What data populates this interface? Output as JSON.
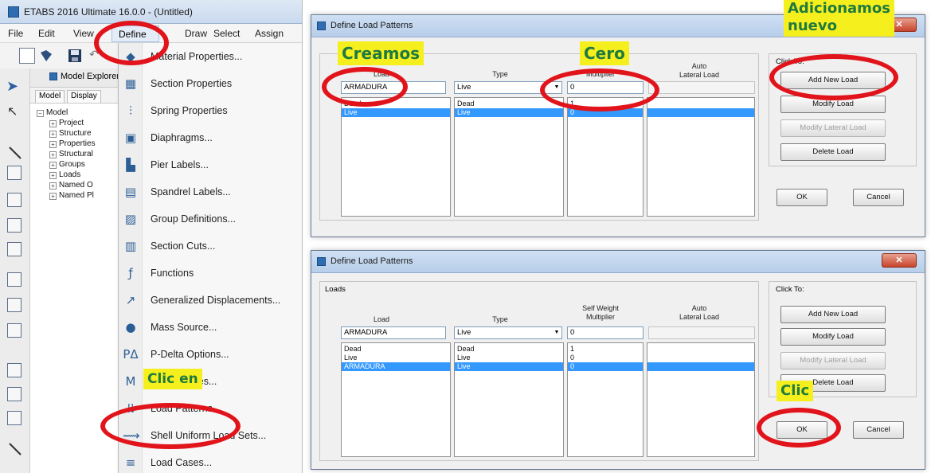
{
  "app": {
    "title": "ETABS 2016 Ultimate 16.0.0 - (Untitled)",
    "menu": [
      "File",
      "Edit",
      "View",
      "Define",
      "Draw",
      "Select",
      "Assign"
    ]
  },
  "explorer": {
    "title": "Model Explorer",
    "tabs": [
      "Model",
      "Display"
    ],
    "tree": [
      {
        "label": "Model",
        "level": 0,
        "sign": "−"
      },
      {
        "label": "Project",
        "level": 1,
        "sign": "+"
      },
      {
        "label": "Structure",
        "level": 1,
        "sign": "+"
      },
      {
        "label": "Properties",
        "level": 1,
        "sign": "+"
      },
      {
        "label": "Structural",
        "level": 1,
        "sign": "+"
      },
      {
        "label": "Groups",
        "level": 1,
        "sign": "+"
      },
      {
        "label": "Loads",
        "level": 1,
        "sign": "+"
      },
      {
        "label": "Named O",
        "level": 1,
        "sign": "+"
      },
      {
        "label": "Named Pl",
        "level": 1,
        "sign": "+"
      }
    ]
  },
  "define_menu": {
    "items": [
      {
        "label": "Material Properties...",
        "icon": "material-icon",
        "glyph": "◆"
      },
      {
        "label": "Section Properties",
        "icon": "section-icon",
        "glyph": "▦"
      },
      {
        "label": "Spring Properties",
        "icon": "spring-icon",
        "glyph": "⫶"
      },
      {
        "label": "Diaphragms...",
        "icon": "diaphragm-icon",
        "glyph": "▣"
      },
      {
        "label": "Pier Labels...",
        "icon": "pier-icon",
        "glyph": "▙"
      },
      {
        "label": "Spandrel Labels...",
        "icon": "spandrel-icon",
        "glyph": "▤"
      },
      {
        "label": "Group Definitions...",
        "icon": "group-icon",
        "glyph": "▨"
      },
      {
        "label": "Section Cuts...",
        "icon": "section-cut-icon",
        "glyph": "▥"
      },
      {
        "label": "Functions",
        "icon": "functions-icon",
        "glyph": "ƒ"
      },
      {
        "label": "Generalized Displacements...",
        "icon": "displacement-icon",
        "glyph": "↗"
      },
      {
        "label": "Mass Source...",
        "icon": "mass-icon",
        "glyph": "●"
      },
      {
        "label": "P-Delta Options...",
        "icon": "pdelta-icon",
        "glyph": "PΔ"
      },
      {
        "label": "Modal Cases...",
        "icon": "modal-icon",
        "glyph": "M"
      },
      {
        "label": "Load Patterns...",
        "icon": "load-patterns-icon",
        "glyph": "⇊"
      },
      {
        "label": "Shell Uniform Load Sets...",
        "icon": "shell-load-icon",
        "glyph": "⟿"
      },
      {
        "label": "Load Cases...",
        "icon": "load-cases-icon",
        "glyph": "≡"
      }
    ]
  },
  "dialog_top": {
    "title": "Define Load Patterns",
    "click_to": "Click To:",
    "headers": {
      "load": "Load",
      "type": "Type",
      "multiplier": "Multiplier",
      "auto": "Auto\nLateral Load"
    },
    "input_load": "ARMADURA",
    "input_type": "Live",
    "input_multiplier": "0",
    "rows": [
      {
        "load": "Dead",
        "type": "Dead",
        "mult": "1",
        "sel": false
      },
      {
        "load": "Live",
        "type": "Live",
        "mult": "0",
        "sel": true
      }
    ],
    "buttons": {
      "add": "Add New Load",
      "modify": "Modify Load",
      "modify_lateral": "Modify Lateral Load",
      "delete": "Delete Load",
      "ok": "OK",
      "cancel": "Cancel"
    }
  },
  "dialog_bottom": {
    "title": "Define Load Patterns",
    "group_label": "Loads",
    "click_to": "Click To:",
    "headers": {
      "load": "Load",
      "type": "Type",
      "multiplier": "Self Weight\nMultiplier",
      "auto": "Auto\nLateral Load"
    },
    "input_load": "ARMADURA",
    "input_type": "Live",
    "input_multiplier": "0",
    "rows": [
      {
        "load": "Dead",
        "type": "Dead",
        "mult": "1",
        "sel": false
      },
      {
        "load": "Live",
        "type": "Live",
        "mult": "0",
        "sel": false
      },
      {
        "load": "ARMADURA",
        "type": "Live",
        "mult": "0",
        "sel": true
      }
    ],
    "buttons": {
      "add": "Add New Load",
      "modify": "Modify Load",
      "modify_lateral": "Modify Lateral Load",
      "delete": "Delete Load",
      "ok": "OK",
      "cancel": "Cancel"
    }
  },
  "annotations": {
    "clic_en": "Clic en",
    "creamos": "Creamos",
    "cero": "Cero",
    "adicionamos": "Adicionamos",
    "nuevo": "nuevo",
    "clic": "Clic"
  },
  "colors": {
    "ring": "#e1141b",
    "note_bg": "#f6ef1e",
    "note_text": "#1f7a3d",
    "selection": "#3399ff"
  }
}
